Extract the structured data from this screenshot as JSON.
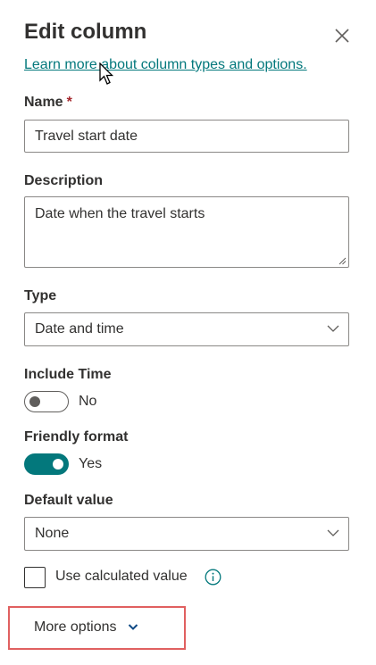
{
  "panel": {
    "title": "Edit column",
    "learn_link": "Learn more about column types and options."
  },
  "name_field": {
    "label": "Name",
    "required_mark": "*",
    "value": "Travel start date"
  },
  "description_field": {
    "label": "Description",
    "value": "Date when the travel starts"
  },
  "type_field": {
    "label": "Type",
    "value": "Date and time"
  },
  "include_time": {
    "label": "Include Time",
    "state": "No",
    "on": false
  },
  "friendly_format": {
    "label": "Friendly format",
    "state": "Yes",
    "on": true
  },
  "default_value": {
    "label": "Default value",
    "value": "None"
  },
  "calculated": {
    "label": "Use calculated value",
    "checked": false
  },
  "more_options": {
    "label": "More options"
  },
  "colors": {
    "accent": "#03787c",
    "required": "#a4262c",
    "highlight_box": "#e06060",
    "text": "#323130",
    "border": "#8a8886"
  },
  "icons": [
    "close-icon",
    "chevron-down-icon",
    "info-icon",
    "mouse-pointer-icon"
  ]
}
